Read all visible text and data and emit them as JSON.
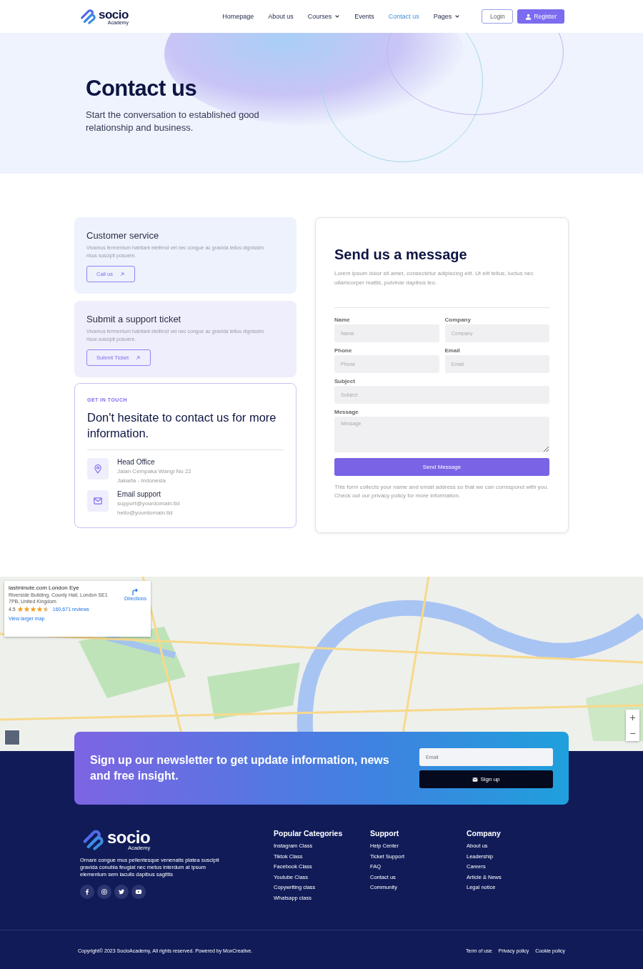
{
  "header": {
    "logo": {
      "name": "socio",
      "tagline": "Academy"
    },
    "nav": [
      {
        "label": "Homepage",
        "selected": false,
        "dropdown": false
      },
      {
        "label": "About us",
        "selected": false,
        "dropdown": false
      },
      {
        "label": "Courses",
        "selected": false,
        "dropdown": true
      },
      {
        "label": "Events",
        "selected": false,
        "dropdown": false
      },
      {
        "label": "Contact us",
        "selected": true,
        "dropdown": false
      },
      {
        "label": "Pages",
        "selected": false,
        "dropdown": true
      }
    ],
    "login": "Login",
    "register": "Register"
  },
  "hero": {
    "title": "Contact us",
    "subtitle": "Start the conversation to established good relationship and business."
  },
  "cards": [
    {
      "kind": "action",
      "title": "Customer service",
      "text": "Vivamus fermentum habitant eleifend vel nec congue ac gravida tellus dignissim risus suscipit posuere.",
      "button": "Call us"
    },
    {
      "kind": "action",
      "title": "Submit a support ticket",
      "text": "Vivamus fermentum habitant eleifend vel nec congue ac gravida tellus dignissim risus suscipit posuere.",
      "button": "Submit Ticket"
    }
  ],
  "touch": {
    "eyebrow": "GET IN TOUCH",
    "title": "Don't hesitate to contact us for more information.",
    "items": [
      {
        "kind": "location",
        "title": "Head Office",
        "lines": [
          "Jalan Cempaka Wangi No 22",
          "Jakarta - Indonesia"
        ]
      },
      {
        "kind": "email",
        "title": "Email support",
        "lines": [
          "support@yourdomain.tld",
          "hello@yourdomain.tld"
        ]
      }
    ]
  },
  "form": {
    "title": "Send us a message",
    "intro": "Lorem ipsum dolor sit amet, consectetur adipiscing elit. Ut elit tellus, luctus nec ullamcorper mattis, pulvinar dapibus leo.",
    "fields": [
      {
        "kind": "half",
        "label": "Name",
        "placeholder": "Name"
      },
      {
        "kind": "half",
        "label": "Company",
        "placeholder": "Company"
      },
      {
        "kind": "half",
        "label": "Phone",
        "placeholder": "Phone"
      },
      {
        "kind": "half",
        "label": "Email",
        "placeholder": "Email"
      },
      {
        "kind": "full",
        "label": "Subject",
        "placeholder": "Subject"
      },
      {
        "kind": "textarea",
        "label": "Message",
        "placeholder": "Message"
      }
    ],
    "submit": "Send Message",
    "note": "This form collects your name and email address so that we can correspond with you. Check out our privacy policy for more information."
  },
  "map": {
    "place": "lastminute.com London Eye",
    "address": "Riverside Building, County Hall, London SE1 7PB, United Kingdom",
    "rating": "4.5",
    "stars": 4.5,
    "reviews": "160,671 reviews",
    "directions": "Directions",
    "larger": "View larger map",
    "zoom_in": "+",
    "zoom_out": "−"
  },
  "newsletter": {
    "title": "Sign up our newsletter to get update information, news and free insight.",
    "placeholder": "Email",
    "button": "Sign up"
  },
  "footer": {
    "logo": {
      "name": "socio",
      "tagline": "Academy"
    },
    "about": "Ornare congue mus pellentesque venenatis platea suscipit gravida conubia feugiat nec metus interdum at ipsum elementum sem iaculis dapibus sagittis",
    "social": [
      {
        "kind": "facebook"
      },
      {
        "kind": "instagram"
      },
      {
        "kind": "twitter"
      },
      {
        "kind": "youtube"
      }
    ],
    "columns": [
      {
        "title": "Popular Categories",
        "links": [
          "Instagram Class",
          "Tiktok Class",
          "Facebook Class",
          "Youtube Class",
          "Copywriting class",
          "Whatsapp class"
        ]
      },
      {
        "title": "Support",
        "links": [
          "Help Center",
          "Ticket Support",
          "FAQ",
          "Contact us",
          "Community"
        ]
      },
      {
        "title": "Company",
        "links": [
          "About us",
          "Leadership",
          "Careers",
          "Article & News",
          "Legal notice"
        ]
      }
    ],
    "copyright": "Copyright© 2023 SocioAcademy, All rights reserved. Powered by MoxCreative.",
    "legal": [
      "Term of use",
      "Privacy policy",
      "Cookie policy"
    ]
  }
}
